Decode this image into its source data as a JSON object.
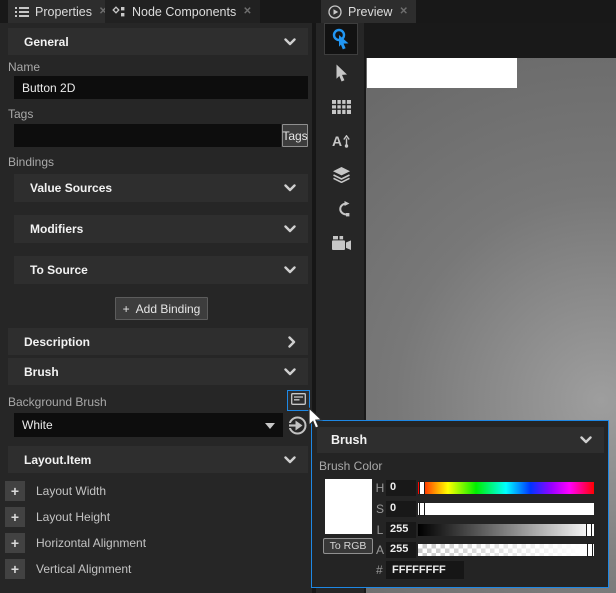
{
  "tabs": {
    "properties": "Properties",
    "node_components": "Node Components",
    "preview": "Preview",
    "close_glyph": "✕"
  },
  "properties_panel": {
    "general_header": "General",
    "name_label": "Name",
    "name_value": "Button 2D",
    "tags_label": "Tags",
    "tags_value": "",
    "tags_button": "Tags",
    "bindings_label": "Bindings",
    "value_sources_header": "Value Sources",
    "modifiers_header": "Modifiers",
    "to_source_header": "To Source",
    "add_binding_plus": "+",
    "add_binding_button": "Add Binding",
    "description_header": "Description",
    "brush_header": "Brush",
    "background_brush_label": "Background Brush",
    "background_brush_value": "White",
    "layout_item_header": "Layout.Item",
    "plus_glyph": "+",
    "layout_rows": [
      {
        "label": "Layout Width"
      },
      {
        "label": "Layout Height"
      },
      {
        "label": "Horizontal Alignment"
      },
      {
        "label": "Vertical Alignment"
      }
    ]
  },
  "brush_popup": {
    "header": "Brush",
    "color_label": "Brush Color",
    "to_rgb_button": "To RGB",
    "channels": [
      {
        "label": "H",
        "value": "0"
      },
      {
        "label": "S",
        "value": "0"
      },
      {
        "label": "L",
        "value": "255"
      },
      {
        "label": "A",
        "value": "255"
      }
    ],
    "hex_prefix": "#",
    "hex_value": "FFFFFFFF",
    "swatch_color": "#ffffff",
    "accent_color": "#1e88e5"
  },
  "preview_canvas": {
    "button_fill": "#ffffff"
  }
}
